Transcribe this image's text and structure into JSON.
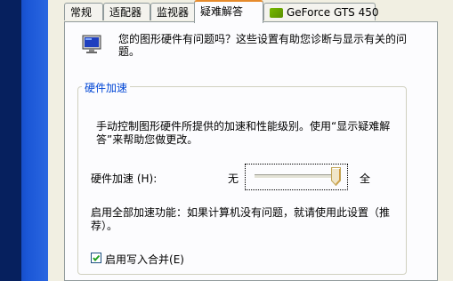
{
  "tabs": [
    {
      "label": "常规"
    },
    {
      "label": "适配器"
    },
    {
      "label": "监视器"
    },
    {
      "label": "疑难解答",
      "active": true
    },
    {
      "label": "GeForce GTS 450",
      "icon": "nvidia-icon"
    }
  ],
  "intro": {
    "icon": "monitor-icon",
    "text": "您的图形硬件有问题吗？这些设置有助您诊断与显示有关的问题。"
  },
  "hardware_acceleration": {
    "group_title": "硬件加速",
    "description": "手动控制图形硬件所提供的加速和性能级别。使用“显示疑难解答”来帮助您做更改。",
    "slider_label": "硬件加速",
    "slider_hotkey": "(H):",
    "slider_min_label": "无",
    "slider_max_label": "全",
    "slider_level": 1.0,
    "note": "启用全部加速功能：如果计算机没有问题，就请使用此设置（推荐）。"
  },
  "write_combining": {
    "label": "启用写入合并",
    "hotkey": "(E)",
    "checked": true
  },
  "colors": {
    "active_tab_accent": "#e68b2c",
    "group_title": "#0046d5",
    "dialog_bg": "#f1efe2",
    "panel_bg": "#fcfcfe"
  }
}
